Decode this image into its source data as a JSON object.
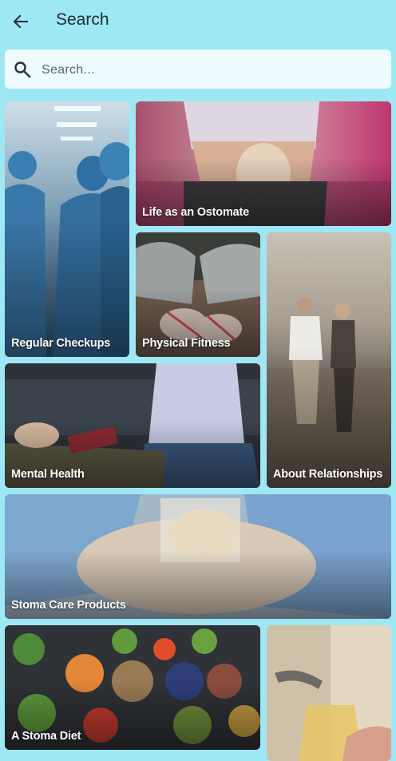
{
  "appbar": {
    "title": "Search",
    "back_icon": "arrow-back-icon"
  },
  "search": {
    "placeholder": "Search...",
    "icon": "search-icon"
  },
  "tiles": [
    {
      "label": "Regular Checkups"
    },
    {
      "label": "Life as an Ostomate"
    },
    {
      "label": "Physical Fitness"
    },
    {
      "label": "About Relationships"
    },
    {
      "label": "Mental Health"
    },
    {
      "label": "Stoma Care Products"
    },
    {
      "label": "A Stoma Diet"
    },
    {
      "label": ""
    }
  ],
  "colors": {
    "background": "#9ee7f5",
    "search_bg": "#eefcff",
    "title": "#1f2a30"
  }
}
